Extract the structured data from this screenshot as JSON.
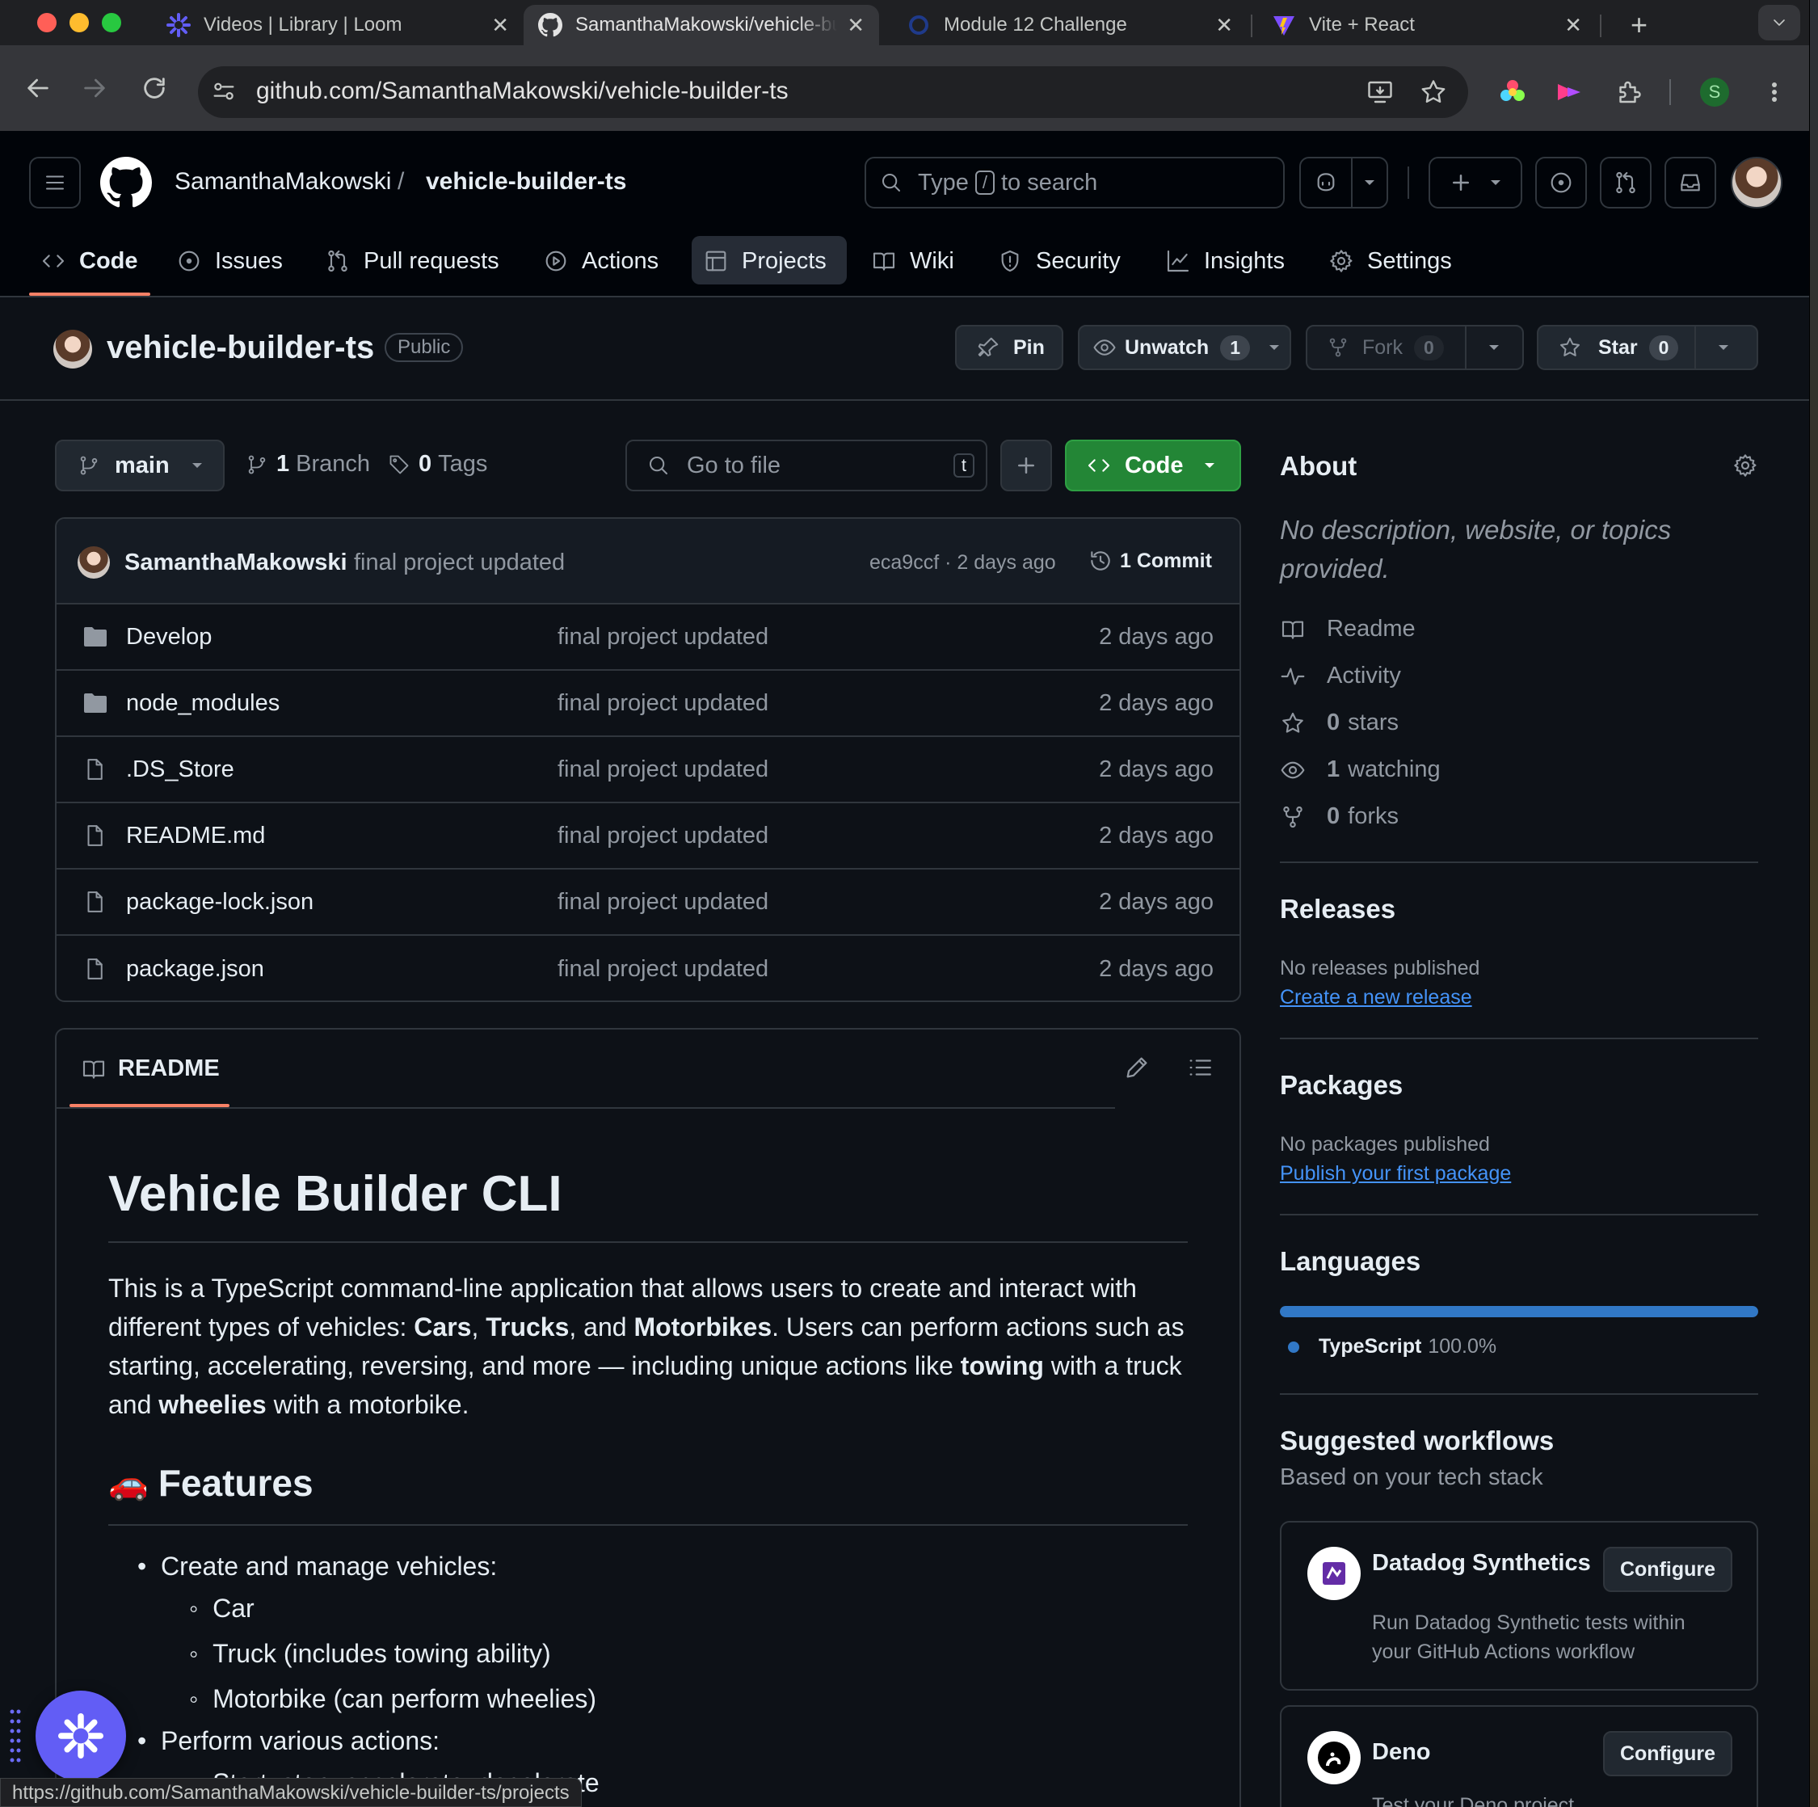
{
  "browser": {
    "tabs": [
      {
        "title": "Videos | Library | Loom"
      },
      {
        "title": "SamanthaMakowski/vehicle-builder-ts"
      },
      {
        "title": "Module 12 Challenge"
      },
      {
        "title": "Vite + React"
      }
    ],
    "url": "github.com/SamanthaMakowski/vehicle-builder-ts",
    "profile_initial": "S",
    "status_url": "https://github.com/SamanthaMakowski/vehicle-builder-ts/projects"
  },
  "header": {
    "owner": "SamanthaMakowski",
    "separator": "/",
    "repo": "vehicle-builder-ts",
    "search_type": "Type",
    "search_key": "/",
    "search_rest": "to search"
  },
  "nav": {
    "items": [
      {
        "label": "Code"
      },
      {
        "label": "Issues"
      },
      {
        "label": "Pull requests"
      },
      {
        "label": "Actions"
      },
      {
        "label": "Projects"
      },
      {
        "label": "Wiki"
      },
      {
        "label": "Security"
      },
      {
        "label": "Insights"
      },
      {
        "label": "Settings"
      }
    ]
  },
  "repo": {
    "name": "vehicle-builder-ts",
    "visibility": "Public",
    "pin": "Pin",
    "unwatch": "Unwatch",
    "watch_count": "1",
    "fork": "Fork",
    "fork_count": "0",
    "star": "Star",
    "star_count": "0"
  },
  "filebar": {
    "branch": "main",
    "branch_count": "1",
    "branch_label": "Branch",
    "tag_count": "0",
    "tag_label": "Tags",
    "goto_placeholder": "Go to file",
    "goto_key": "t",
    "code_button": "Code"
  },
  "commit": {
    "author": "SamanthaMakowski",
    "message": "final project updated",
    "hash_time": "eca9ccf · 2 days ago",
    "commits": "1 Commit"
  },
  "files": [
    {
      "name": "Develop",
      "type": "folder",
      "message": "final project updated",
      "age": "2 days ago"
    },
    {
      "name": "node_modules",
      "type": "folder",
      "message": "final project updated",
      "age": "2 days ago"
    },
    {
      "name": ".DS_Store",
      "type": "file",
      "message": "final project updated",
      "age": "2 days ago"
    },
    {
      "name": "README.md",
      "type": "file",
      "message": "final project updated",
      "age": "2 days ago"
    },
    {
      "name": "package-lock.json",
      "type": "file",
      "message": "final project updated",
      "age": "2 days ago"
    },
    {
      "name": "package.json",
      "type": "file",
      "message": "final project updated",
      "age": "2 days ago"
    }
  ],
  "readme": {
    "tab": "README",
    "title": "Vehicle Builder CLI",
    "p_1": "This is a TypeScript command-line application that allows users to create and interact with different types of vehicles: ",
    "p_cars": "Cars",
    "p_comma": ", ",
    "p_trucks": "Trucks",
    "p_and": ", and ",
    "p_motorbikes": "Motorbikes",
    "p_2": ". Users can perform actions such as starting, accelerating, reversing, and more — including unique actions like ",
    "p_towing": "towing",
    "p_3": " with a truck and ",
    "p_wheelies": "wheelies",
    "p_4": " with a motorbike.",
    "features_emoji": "🚗",
    "features_heading": "Features",
    "bullet_1": "Create and manage vehicles:",
    "sub_1": "Car",
    "sub_2": "Truck (includes towing ability)",
    "sub_3": "Motorbike (can perform wheelies)",
    "bullet_2": "Perform various actions:",
    "sub_4": "Start, stop, accelerate, decelerate"
  },
  "about": {
    "heading": "About",
    "description": "No description, website, or topics provided.",
    "readme": "Readme",
    "activity": "Activity",
    "stars_count": "0",
    "stars_label": "stars",
    "watching_count": "1",
    "watching_label": "watching",
    "forks_count": "0",
    "forks_label": "forks"
  },
  "releases": {
    "heading": "Releases",
    "empty": "No releases published",
    "link": "Create a new release"
  },
  "packages": {
    "heading": "Packages",
    "empty": "No packages published",
    "link": "Publish your first package"
  },
  "languages": {
    "heading": "Languages",
    "name": "TypeScript",
    "percent": "100.0%",
    "share": 1.0,
    "color": "#3178c6"
  },
  "workflows": {
    "heading": "Suggested workflows",
    "subheading": "Based on your tech stack",
    "items": [
      {
        "name": "Datadog Synthetics",
        "button": "Configure",
        "desc_1": "Run Datadog Synthetic tests within",
        "desc_2": "your GitHub Actions workflow"
      },
      {
        "name": "Deno",
        "button": "Configure",
        "desc_1": "Test your Deno project",
        "desc_2": ""
      }
    ]
  },
  "colors": {
    "accent_green": "#238636",
    "link_blue": "#4493f8",
    "nav_underline": "#f78166",
    "bg": "#0d1117"
  }
}
